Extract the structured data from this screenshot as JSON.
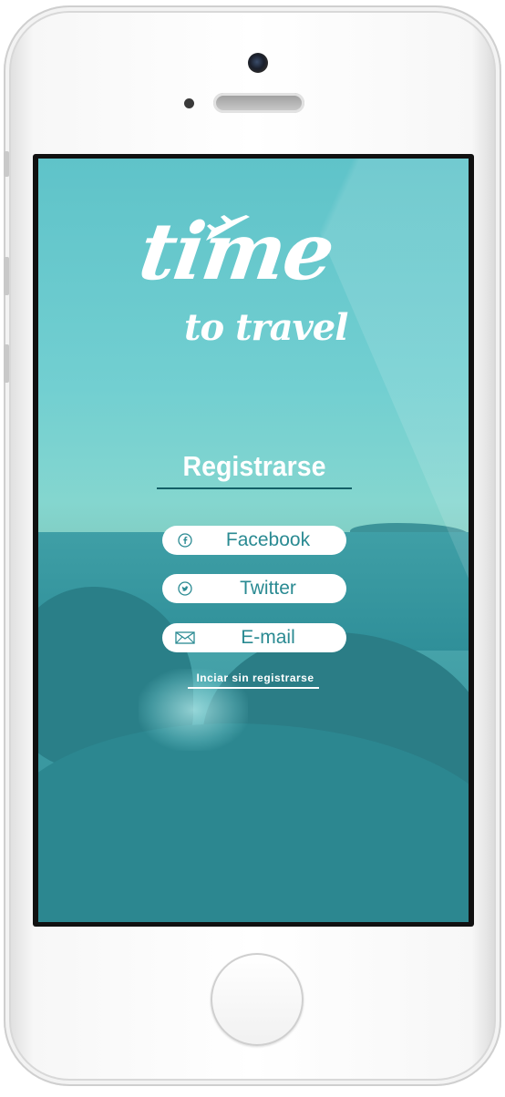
{
  "app": {
    "logo_text": "time",
    "logo_subtext": "to travel"
  },
  "register": {
    "title": "Registrarse",
    "buttons": [
      {
        "label": "Facebook",
        "icon": "facebook-icon"
      },
      {
        "label": "Twitter",
        "icon": "twitter-icon"
      },
      {
        "label": "E-mail",
        "icon": "mail-icon"
      }
    ],
    "skip_link": "Inciar sin registrarse"
  },
  "colors": {
    "accent": "#2a8a92",
    "title_underline": "#135f66"
  }
}
